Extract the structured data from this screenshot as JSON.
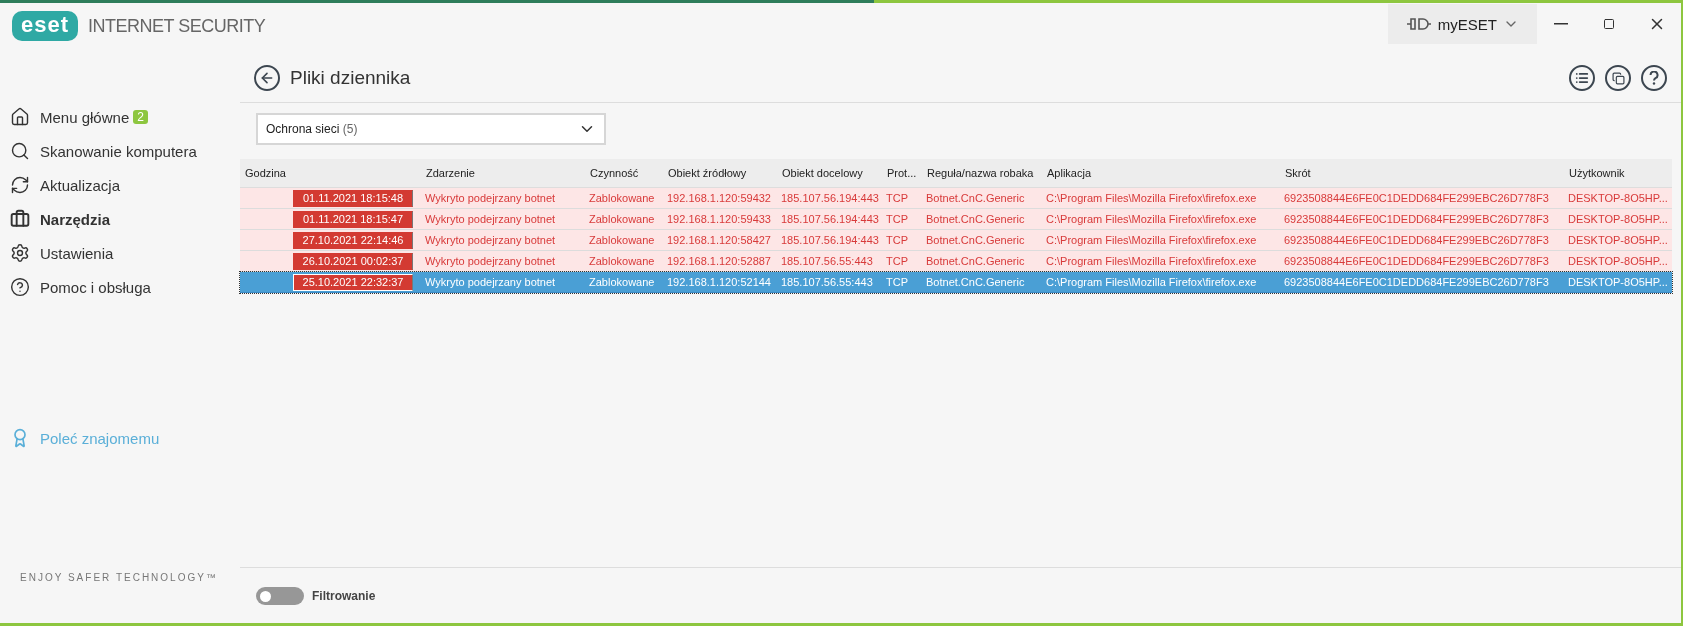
{
  "app": {
    "logo": "eset",
    "product": "INTERNET SECURITY"
  },
  "titlebar": {
    "account_button": "myESET"
  },
  "sidebar": {
    "items": [
      {
        "label": "Menu główne",
        "badge": "2",
        "selected": false
      },
      {
        "label": "Skanowanie komputera",
        "selected": false
      },
      {
        "label": "Aktualizacja",
        "selected": false
      },
      {
        "label": "Narzędzia",
        "selected": true
      },
      {
        "label": "Ustawienia",
        "selected": false
      },
      {
        "label": "Pomoc i obsługa",
        "selected": false
      }
    ],
    "referral": "Poleć znajomemu",
    "slogan": "ENJOY SAFER TECHNOLOGY™"
  },
  "page": {
    "title": "Pliki dziennika",
    "log_select": {
      "value": "Ochrona sieci",
      "count": "(5)"
    }
  },
  "table": {
    "columns": [
      "Godzina",
      "Zdarzenie",
      "Czynność",
      "Obiekt źródłowy",
      "Obiekt docelowy",
      "Prot...",
      "Reguła/nazwa robaka",
      "Aplikacja",
      "Skrót",
      "Użytkownik"
    ],
    "rows": [
      {
        "selected": false,
        "cells": [
          "01.11.2021 18:15:48",
          "Wykryto podejrzany botnet",
          "Zablokowane",
          "192.168.1.120:59432",
          "185.107.56.194:443",
          "TCP",
          "Botnet.CnC.Generic",
          "C:\\Program Files\\Mozilla Firefox\\firefox.exe",
          "6923508844E6FE0C1DEDD684FE299EBC26D778F3",
          "DESKTOP-8O5HP..."
        ]
      },
      {
        "selected": false,
        "cells": [
          "01.11.2021 18:15:47",
          "Wykryto podejrzany botnet",
          "Zablokowane",
          "192.168.1.120:59433",
          "185.107.56.194:443",
          "TCP",
          "Botnet.CnC.Generic",
          "C:\\Program Files\\Mozilla Firefox\\firefox.exe",
          "6923508844E6FE0C1DEDD684FE299EBC26D778F3",
          "DESKTOP-8O5HP..."
        ]
      },
      {
        "selected": false,
        "cells": [
          "27.10.2021 22:14:46",
          "Wykryto podejrzany botnet",
          "Zablokowane",
          "192.168.1.120:58427",
          "185.107.56.194:443",
          "TCP",
          "Botnet.CnC.Generic",
          "C:\\Program Files\\Mozilla Firefox\\firefox.exe",
          "6923508844E6FE0C1DEDD684FE299EBC26D778F3",
          "DESKTOP-8O5HP..."
        ]
      },
      {
        "selected": false,
        "cells": [
          "26.10.2021 00:02:37",
          "Wykryto podejrzany botnet",
          "Zablokowane",
          "192.168.1.120:52887",
          "185.107.56.55:443",
          "TCP",
          "Botnet.CnC.Generic",
          "C:\\Program Files\\Mozilla Firefox\\firefox.exe",
          "6923508844E6FE0C1DEDD684FE299EBC26D778F3",
          "DESKTOP-8O5HP..."
        ]
      },
      {
        "selected": true,
        "cells": [
          "25.10.2021 22:32:37",
          "Wykryto podejrzany botnet",
          "Zablokowane",
          "192.168.1.120:52144",
          "185.107.56.55:443",
          "TCP",
          "Botnet.CnC.Generic",
          "C:\\Program Files\\Mozilla Firefox\\firefox.exe",
          "6923508844E6FE0C1DEDD684FE299EBC26D778F3",
          "DESKTOP-8O5HP..."
        ]
      }
    ]
  },
  "footer": {
    "filter_toggle": {
      "label": "Filtrowanie",
      "on": false
    }
  }
}
